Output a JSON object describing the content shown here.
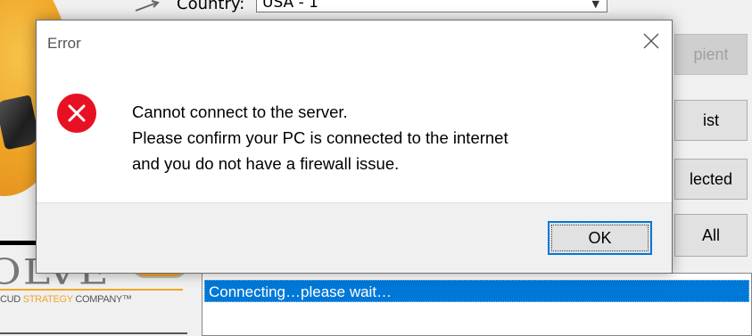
{
  "dialog": {
    "title": "Error",
    "message_lines": [
      "Cannot connect to the server.",
      "Please confirm your PC is connected to the internet",
      "and you do not have a firewall issue."
    ],
    "ok_label": "OK",
    "icons": {
      "error": "error-x-circle-icon",
      "close": "close-icon"
    },
    "colors": {
      "error_red": "#e81123",
      "focus_blue": "#0078d7"
    }
  },
  "app": {
    "country": {
      "label": "Country:",
      "value": "USA - 1"
    },
    "side_buttons": [
      "pient",
      "ist",
      "lected",
      "All"
    ],
    "logo": {
      "text": "OLVE",
      "badge": "II",
      "tagline_prefix": "CUD ",
      "tagline_highlight": "STRATEGY",
      "tagline_suffix": " COMPANY™"
    },
    "status_list": {
      "items": [
        "Connecting…please wait…"
      ]
    },
    "colors": {
      "selection_blue": "#0078d7",
      "brand_orange": "#f0a526"
    }
  }
}
